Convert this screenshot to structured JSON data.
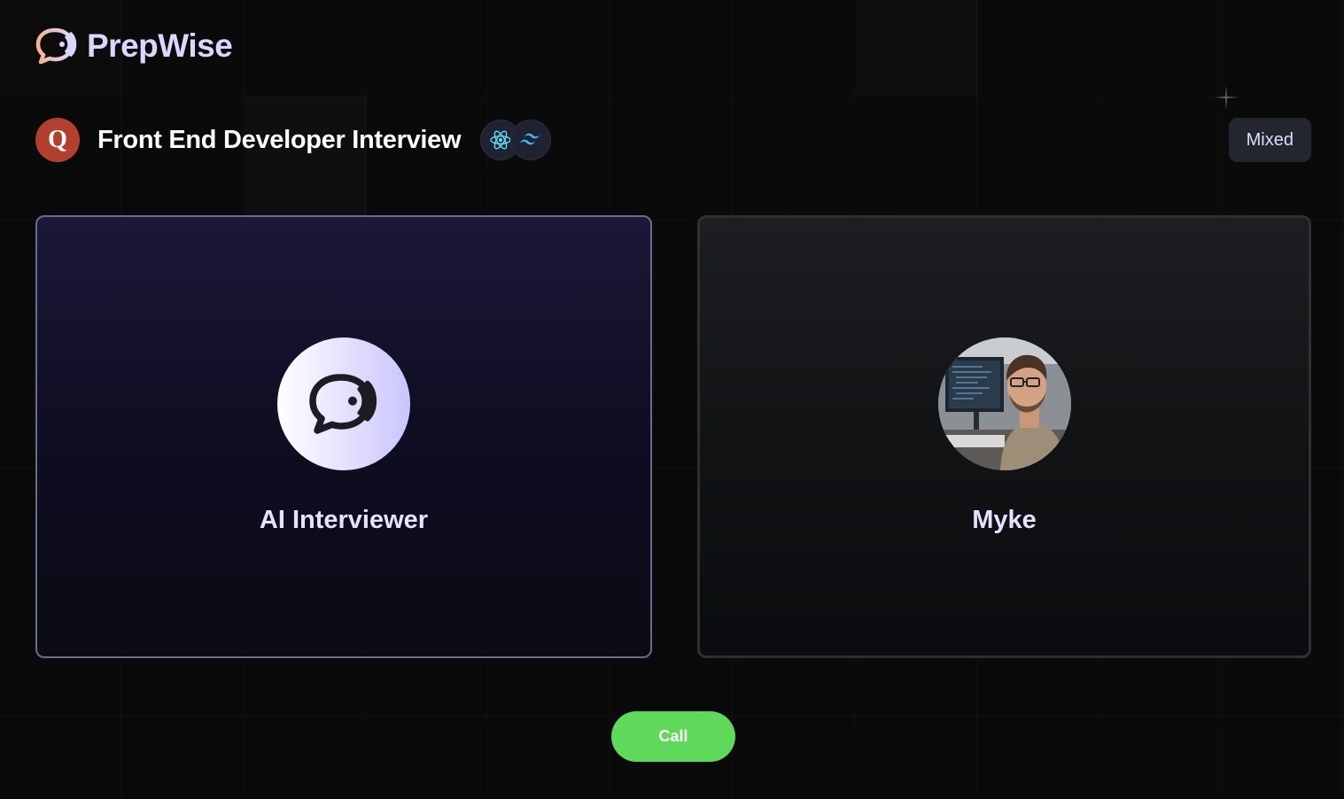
{
  "app": {
    "brand_name": "PrepWise",
    "logo_icon": "chat-bubble-sound-icon"
  },
  "interview": {
    "company_initial": "Q",
    "title": "Front End Developer Interview",
    "tech_stack": [
      "react-icon",
      "tailwind-icon"
    ],
    "type": "Mixed"
  },
  "participants": {
    "interviewer": {
      "name": "AI Interviewer",
      "avatar_icon": "chat-bubble-sound-icon"
    },
    "user": {
      "name": "Myke",
      "avatar_icon": "profile-photo"
    }
  },
  "actions": {
    "call_label": "Call"
  },
  "colors": {
    "background": "#0a0a0b",
    "brand_text": "#dcd6ff",
    "call_button": "#5fd95a",
    "company_logo": "#b3402f",
    "interviewer_card_border": "#6b6a8f"
  }
}
